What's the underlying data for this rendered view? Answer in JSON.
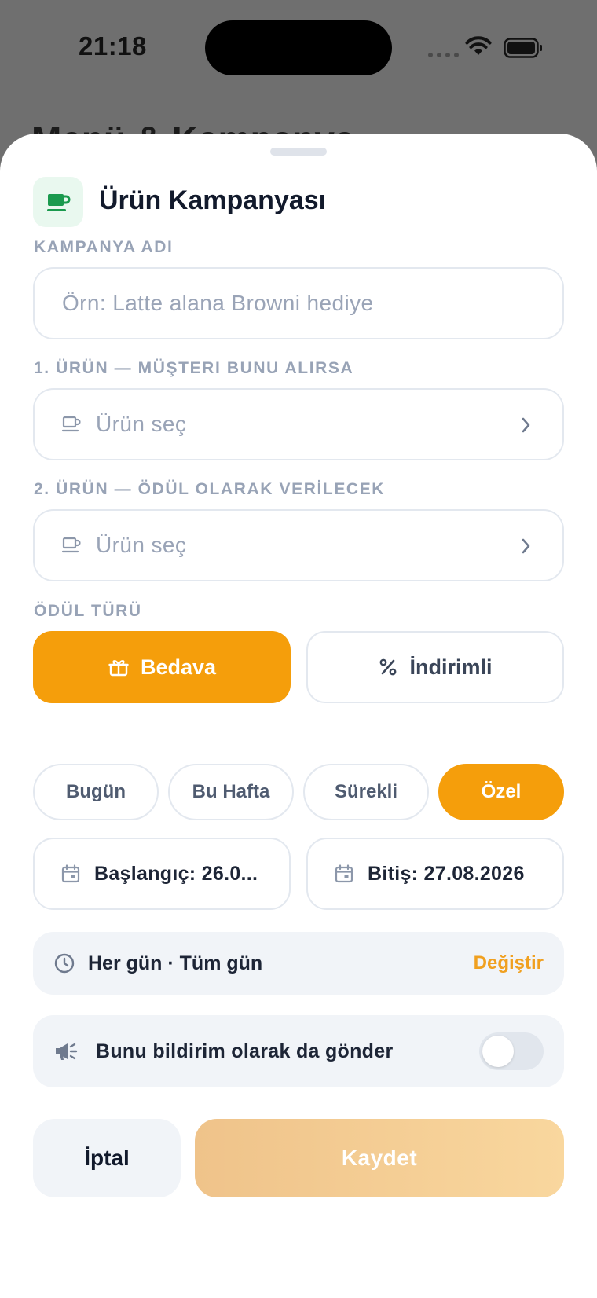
{
  "status_bar": {
    "time": "21:18"
  },
  "background": {
    "title": "Menü & Kampanya"
  },
  "sheet": {
    "title": "Ürün Kampanyası",
    "title_icon": "coffee-cup-icon",
    "campaign_name": {
      "label": "KAMPANYA ADI",
      "placeholder": "Örn: Latte alana Browni hediye",
      "value": ""
    },
    "product_1": {
      "label": "1. ÜRÜN — MÜŞTERI BUNU ALIRSA",
      "placeholder": "Ürün seç"
    },
    "product_2": {
      "label": "2. ÜRÜN — ÖDÜL OLARAK VERİLECEK",
      "placeholder": "Ürün seç"
    },
    "reward_type": {
      "label": "ÖDÜL TÜRÜ",
      "options": [
        {
          "label": "Bedava",
          "icon": "gift-icon",
          "selected": true
        },
        {
          "label": "İndirimli",
          "icon": "percent-icon",
          "selected": false
        }
      ]
    },
    "period": {
      "options": [
        {
          "label": "Bugün",
          "selected": false
        },
        {
          "label": "Bu Hafta",
          "selected": false
        },
        {
          "label": "Sürekli",
          "selected": false
        },
        {
          "label": "Özel",
          "selected": true
        }
      ]
    },
    "dates": {
      "start": "Başlangıç: 26.0...",
      "end": "Bitiş: 27.08.2026"
    },
    "schedule": {
      "text": "Her gün · Tüm gün",
      "action": "Değiştir"
    },
    "notification": {
      "text": "Bunu bildirim olarak da gönder",
      "enabled": false
    },
    "actions": {
      "cancel": "İptal",
      "save": "Kaydet"
    }
  },
  "colors": {
    "accent": "#f59e0b",
    "accent_text": "#f0a020",
    "icon_green": "#1a9a4e",
    "muted_label": "#98a3b6",
    "panel_bg": "#f1f4f8"
  }
}
